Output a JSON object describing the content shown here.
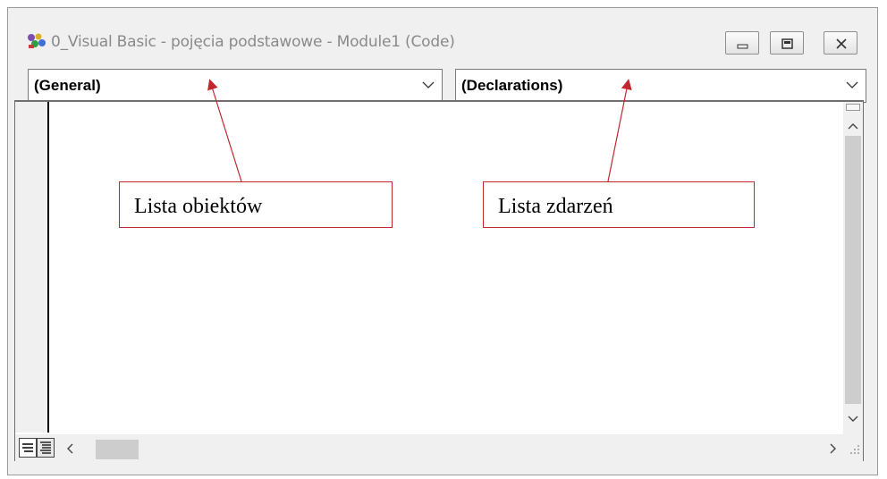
{
  "window": {
    "title": "0_Visual Basic - pojęcia podstawowe - Module1 (Code)",
    "controls": [
      "minimize",
      "maximize",
      "close"
    ]
  },
  "toolbar": {
    "object_list": {
      "value": "(General)"
    },
    "procedure_list": {
      "value": "(Declarations)"
    }
  },
  "annotations": {
    "object_list_label": "Lista obiektów",
    "event_list_label": "Lista zdarzeń",
    "color": "#c0282f"
  },
  "icons": [
    "vba-project-icon",
    "chevron-down-icon",
    "scroll-up-icon",
    "scroll-down-icon",
    "scroll-left-icon",
    "scroll-right-icon",
    "procedure-view-icon",
    "full-module-view-icon",
    "resize-grip-icon"
  ]
}
